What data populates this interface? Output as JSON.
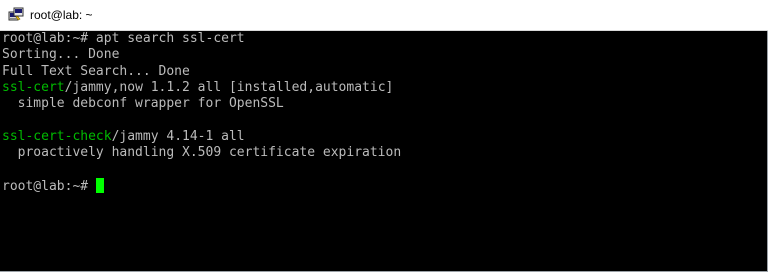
{
  "window": {
    "title": "root@lab: ~",
    "icon": "putty-terminal-icon"
  },
  "colors": {
    "background": "#000000",
    "text": "#bbbbbb",
    "highlight": "#00ba00",
    "cursor": "#00ff00"
  },
  "terminal": {
    "prompt1": "root@lab:~# ",
    "command1": "apt search ssl-cert",
    "line_sorting": "Sorting... Done",
    "line_fulltext": "Full Text Search... Done",
    "pkg1_name": "ssl-cert",
    "pkg1_rest": "/jammy,now 1.1.2 all [installed,automatic]",
    "pkg1_desc": "  simple debconf wrapper for OpenSSL",
    "pkg2_name": "ssl-cert-check",
    "pkg2_rest": "/jammy 4.14-1 all",
    "pkg2_desc": "  proactively handling X.509 certificate expiration",
    "prompt2": "root@lab:~# "
  }
}
